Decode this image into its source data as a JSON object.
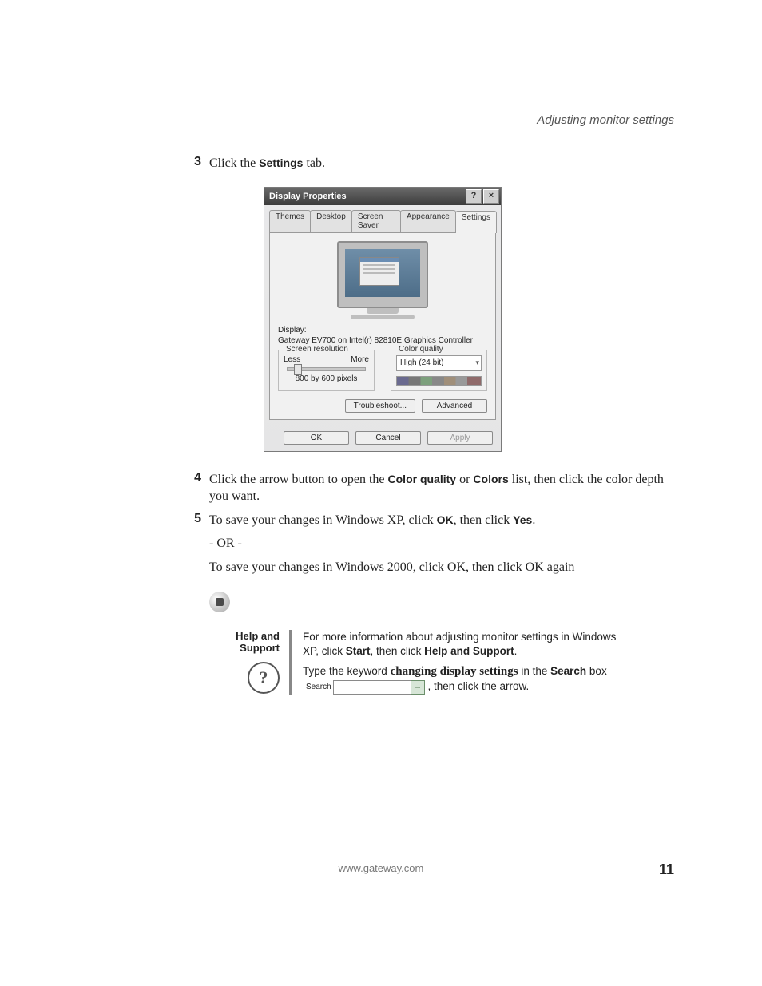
{
  "header": {
    "running_title": "Adjusting monitor settings"
  },
  "steps": {
    "s3": {
      "num": "3",
      "pre": "Click the ",
      "bold": "Settings",
      "post": " tab."
    },
    "s4": {
      "num": "4",
      "pre": "Click the arrow button to open the ",
      "bold1": "Color quality",
      "mid": " or ",
      "bold2": "Colors",
      "post": " list, then click the color depth you want."
    },
    "s5": {
      "num": "5",
      "pre": "To save your changes in Windows XP, click ",
      "bold1": "OK",
      "mid": ", then click ",
      "bold2": "Yes",
      "post": "."
    },
    "s5_or": "- OR -",
    "s5b": {
      "pre": "To save your changes in Windows 2000, click ",
      "bold1": "OK",
      "mid": ", then click ",
      "bold2": "OK",
      "post": " again"
    }
  },
  "dialog": {
    "title": "Display Properties",
    "help_btn": "?",
    "close_btn": "×",
    "tabs": {
      "t0": "Themes",
      "t1": "Desktop",
      "t2": "Screen Saver",
      "t3": "Appearance",
      "t4": "Settings"
    },
    "display_label": "Display:",
    "display_value": "Gateway EV700 on Intel(r) 82810E Graphics Controller",
    "screen_res_legend": "Screen resolution",
    "less": "Less",
    "more": "More",
    "res_value": "800 by 600 pixels",
    "color_legend": "Color quality",
    "color_value": "High (24 bit)",
    "troubleshoot": "Troubleshoot...",
    "advanced": "Advanced",
    "ok": "OK",
    "cancel": "Cancel",
    "apply": "Apply"
  },
  "help": {
    "heading1": "Help and",
    "heading2": "Support",
    "line1_pre": "For more information about adjusting monitor settings in Windows XP, click ",
    "line1_b1": "Start",
    "line1_mid": ", then click ",
    "line1_b2": "Help and Support",
    "line1_post": ".",
    "line2_pre": "Type the keyword ",
    "line2_kw": "changing display settings",
    "line2_mid": " in the ",
    "line2_b": "Search",
    "line2_post1": " box ",
    "search_label": "Search",
    "line2_post2": " , then click the arrow."
  },
  "footer": {
    "url": "www.gateway.com",
    "page": "11"
  }
}
